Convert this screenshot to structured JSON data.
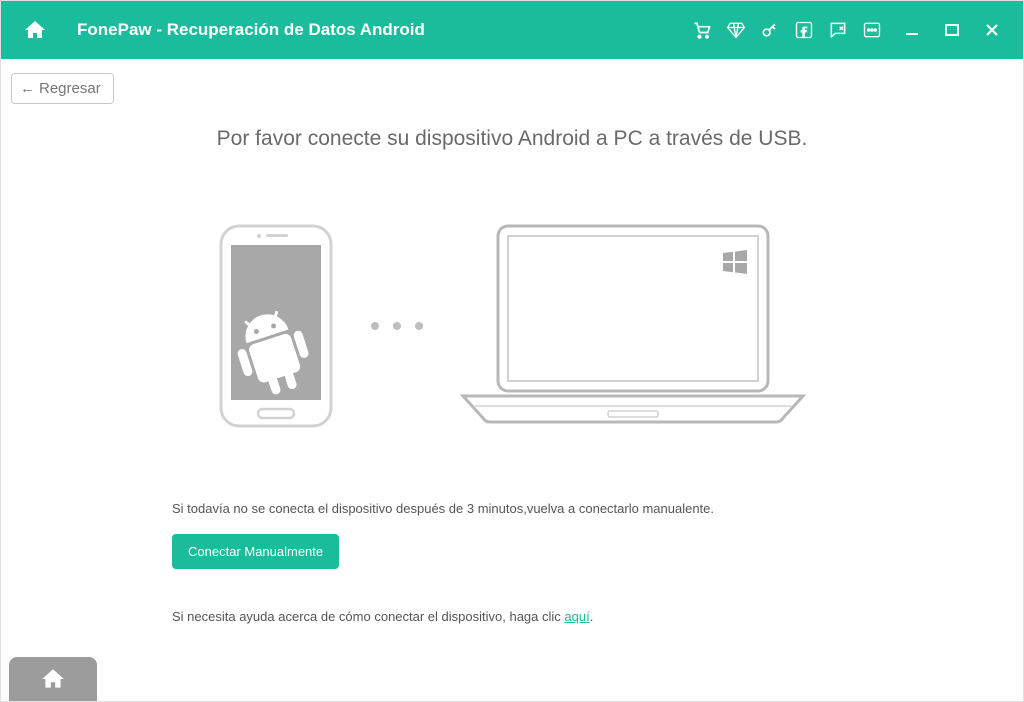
{
  "titlebar": {
    "title": "FonePaw - Recuperación de Datos Android"
  },
  "back_button": {
    "label": "Regresar"
  },
  "main": {
    "instruction": "Por favor conecte su dispositivo Android a PC a través de USB."
  },
  "hints": {
    "not_connected": "Si todavía no se conecta el dispositivo después de 3 minutos,vuelva a conectarlo manualente.",
    "manual_button": "Conectar Manualmente",
    "help_prefix": "Si necesita ayuda acerca de cómo conectar el dispositivo, haga clic ",
    "help_link": "aquí",
    "help_suffix": "."
  },
  "colors": {
    "accent": "#1abc9c"
  }
}
